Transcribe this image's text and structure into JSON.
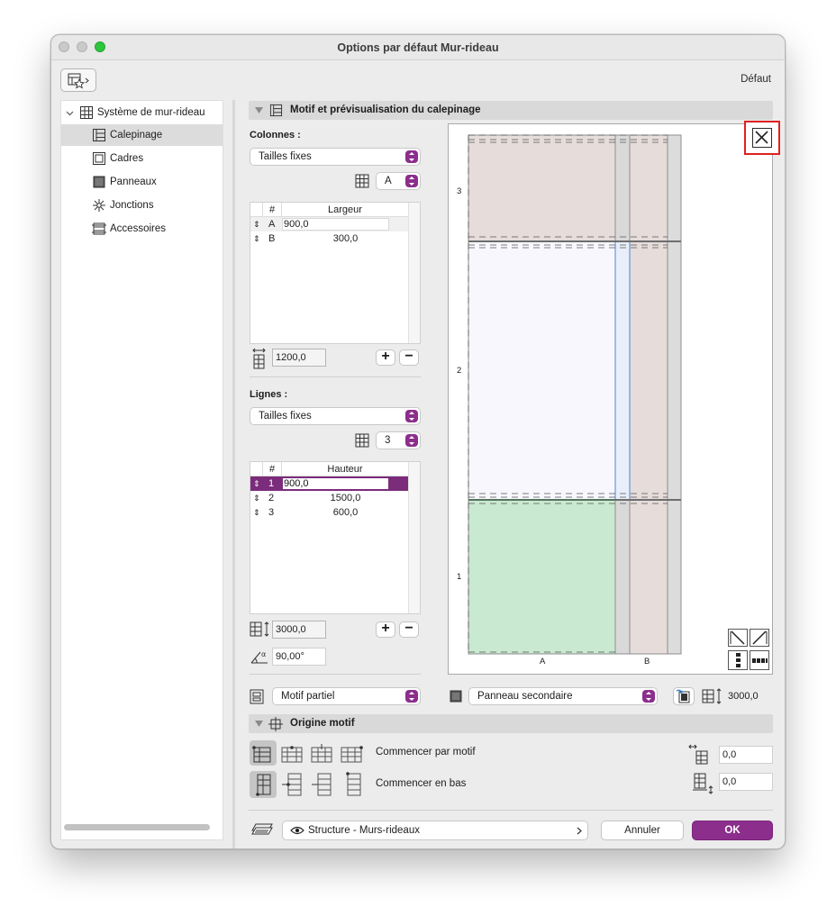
{
  "window": {
    "title": "Options par défaut Mur-rideau"
  },
  "header": {
    "default_label": "Défaut"
  },
  "sidebar": {
    "items": [
      {
        "label": "Système de mur-rideau",
        "icon": "grid-icon"
      },
      {
        "label": "Calepinage",
        "icon": "scheme-icon"
      },
      {
        "label": "Cadres",
        "icon": "frame-icon"
      },
      {
        "label": "Panneaux",
        "icon": "panel-icon"
      },
      {
        "label": "Jonctions",
        "icon": "junction-icon"
      },
      {
        "label": "Accessoires",
        "icon": "accessory-icon"
      }
    ]
  },
  "section1": {
    "title": "Motif et prévisualisation du calepinage"
  },
  "columns": {
    "label": "Colonnes :",
    "mode": "Tailles fixes",
    "selector": "A",
    "header_num": "#",
    "header_width": "Largeur",
    "rows": [
      {
        "id": "A",
        "value": "900,0"
      },
      {
        "id": "B",
        "value": "300,0"
      }
    ],
    "total": "1200,0"
  },
  "lines": {
    "label": "Lignes :",
    "mode": "Tailles fixes",
    "selector": "3",
    "header_num": "#",
    "header_height": "Hauteur",
    "rows": [
      {
        "id": "1",
        "value": "900,0"
      },
      {
        "id": "2",
        "value": "1500,0"
      },
      {
        "id": "3",
        "value": "600,0"
      }
    ],
    "total": "3000,0",
    "angle": "90,00°"
  },
  "preview": {
    "row_labels": [
      "3",
      "2",
      "1"
    ],
    "col_labels": [
      "A",
      "B"
    ],
    "colors": {
      "panel_beige": "#e6dcd9",
      "panel_white": "#f7f7fd",
      "panel_green": "#c9e9d0",
      "frame": "#d9d9d9",
      "selected_line": "#4a86d8"
    }
  },
  "pattern": {
    "mode": "Motif partiel",
    "panel": "Panneau secondaire",
    "height": "3000,0"
  },
  "section2": {
    "title": "Origine motif",
    "start_label": "Commencer par motif",
    "bottom_label": "Commencer en bas",
    "offset_x": "0,0",
    "offset_y": "0,0"
  },
  "footer": {
    "layer": "Structure - Murs-rideaux",
    "cancel": "Annuler",
    "ok": "OK"
  },
  "accent": "#8c2e8c"
}
